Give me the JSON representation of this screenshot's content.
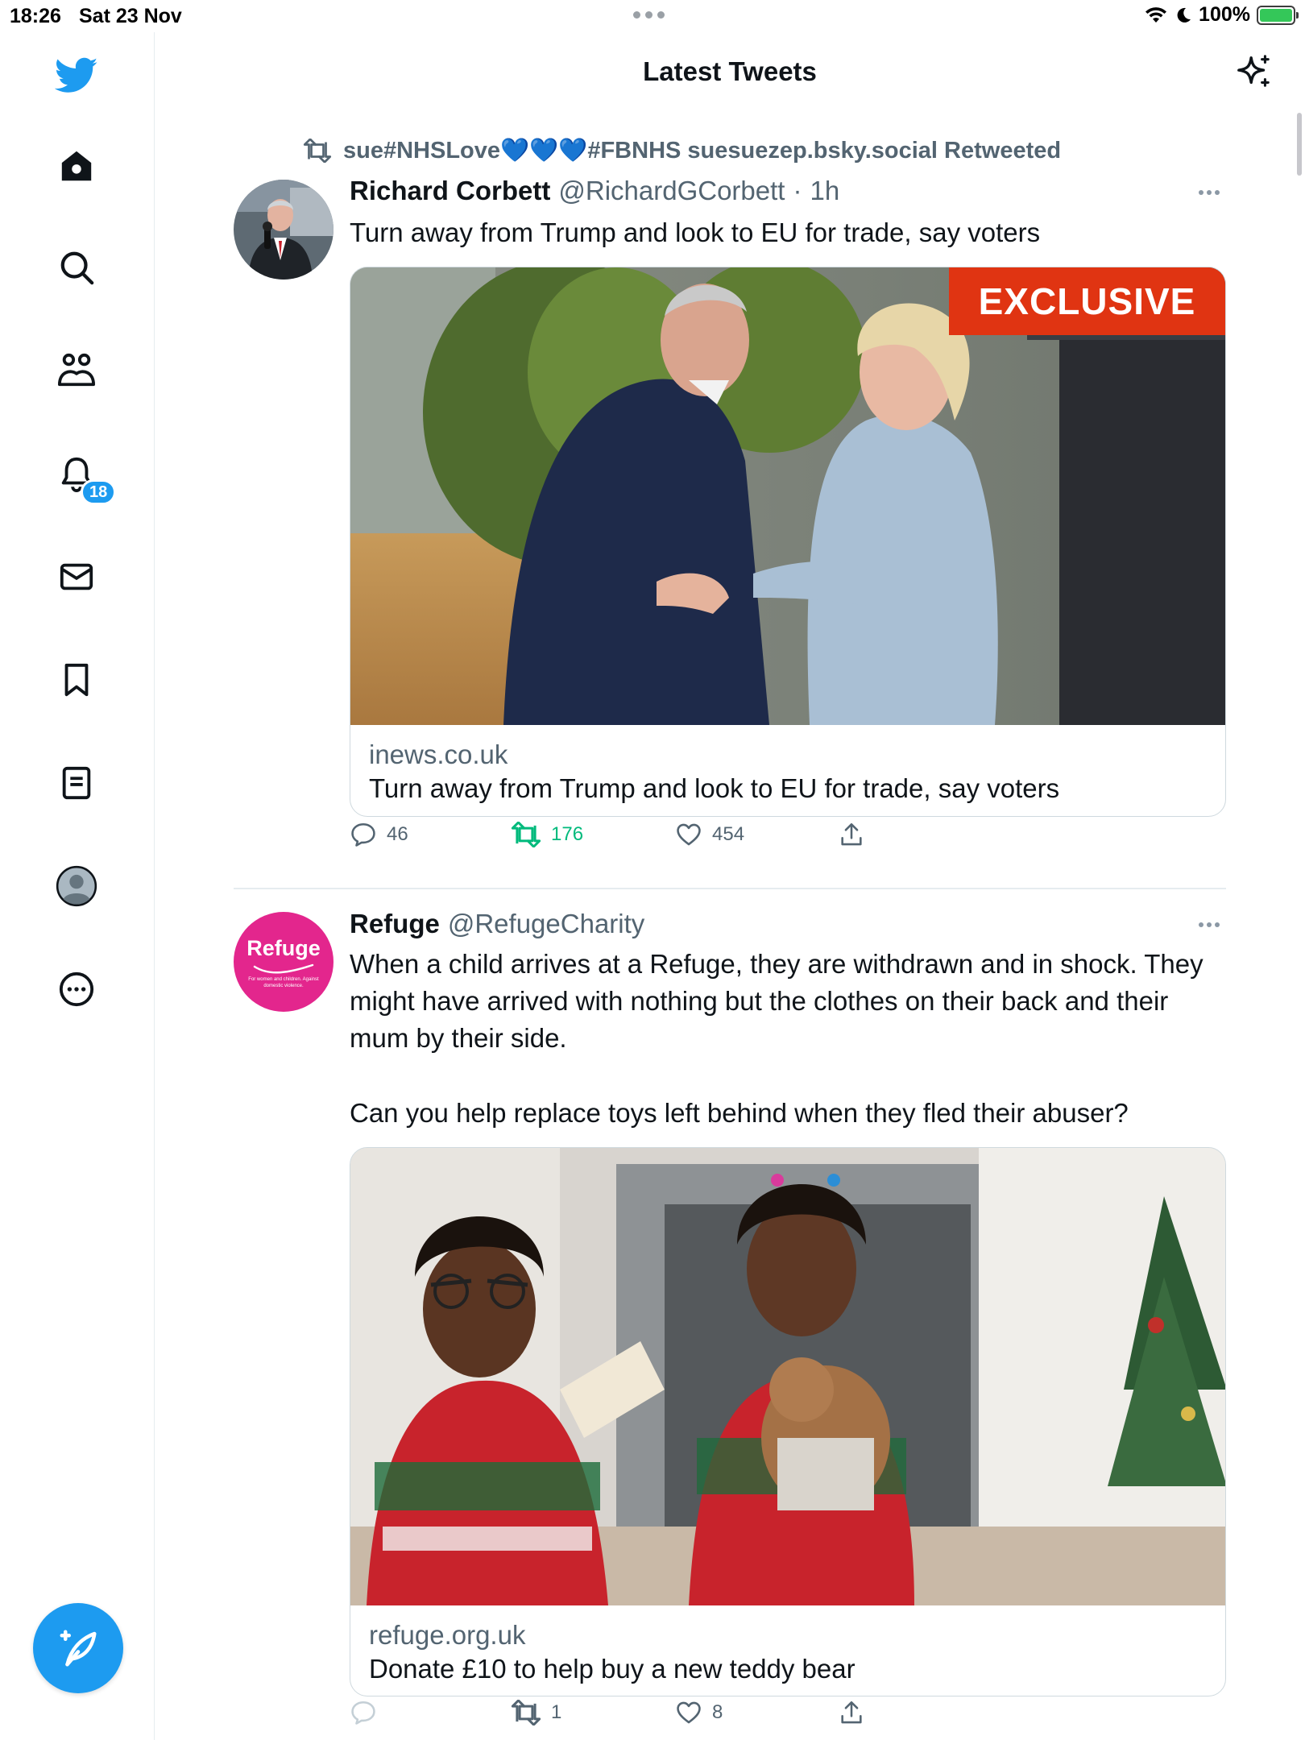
{
  "status_bar": {
    "time": "18:26",
    "date": "Sat 23 Nov",
    "battery": "100%"
  },
  "header": {
    "title": "Latest Tweets"
  },
  "sidebar": {
    "items": [
      {
        "icon": "home-icon"
      },
      {
        "icon": "search-icon"
      },
      {
        "icon": "communities-icon"
      },
      {
        "icon": "bell-icon"
      },
      {
        "icon": "mail-icon"
      },
      {
        "icon": "bookmark-icon"
      },
      {
        "icon": "lists-icon"
      },
      {
        "icon": "profile-icon"
      },
      {
        "icon": "more-icon"
      }
    ],
    "notification_count": "18"
  },
  "colors": {
    "accent": "#1d9bf0",
    "retweet_green": "#00ba7c",
    "muted": "#536471"
  },
  "tweets": [
    {
      "retweeted_by": "sue#NHSLove💙💙💙#FBNHS suesuezep.bsky.social Retweeted",
      "name": "Richard Corbett",
      "handle": "@RichardGCorbett",
      "separator": "·",
      "time": "1h",
      "text": "Turn away from Trump and look to EU for trade, say voters",
      "card": {
        "badge": "EXCLUSIVE",
        "domain": "inews.co.uk",
        "title": "Turn away from Trump and look to EU for trade, say voters"
      },
      "replies": "46",
      "retweets": "176",
      "likes": "454"
    },
    {
      "name": "Refuge",
      "handle": "@RefugeCharity",
      "avatar_text": "Refuge",
      "avatar_sub": "For women and children. Against domestic violence.",
      "text_p1": "When a child arrives at a Refuge, they are withdrawn and in shock. They might have arrived with nothing but the clothes on their back and their mum by their side.",
      "text_p2": "Can you help replace toys left behind when they fled their abuser?",
      "card": {
        "domain": "refuge.org.uk",
        "title": "Donate £10 to help buy a new teddy bear"
      },
      "retweets": "1",
      "likes": "8"
    }
  ]
}
